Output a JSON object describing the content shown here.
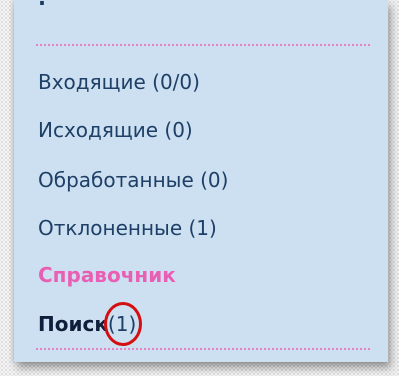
{
  "menu": {
    "items": [
      {
        "label": "Входящие (0/0)"
      },
      {
        "label": "Исходящие (0)"
      },
      {
        "label": "Обработанные (0)"
      },
      {
        "label": "Отклоненные (1)"
      },
      {
        "label": "Справочник"
      },
      {
        "label": "Поиск",
        "count": "(1)"
      }
    ]
  },
  "colors": {
    "panel_background": "#cde0f1",
    "link_text": "#1e3f66",
    "highlight_link": "#e95fb3",
    "divider": "#e882c4",
    "annotation_circle": "#d40f0f"
  }
}
